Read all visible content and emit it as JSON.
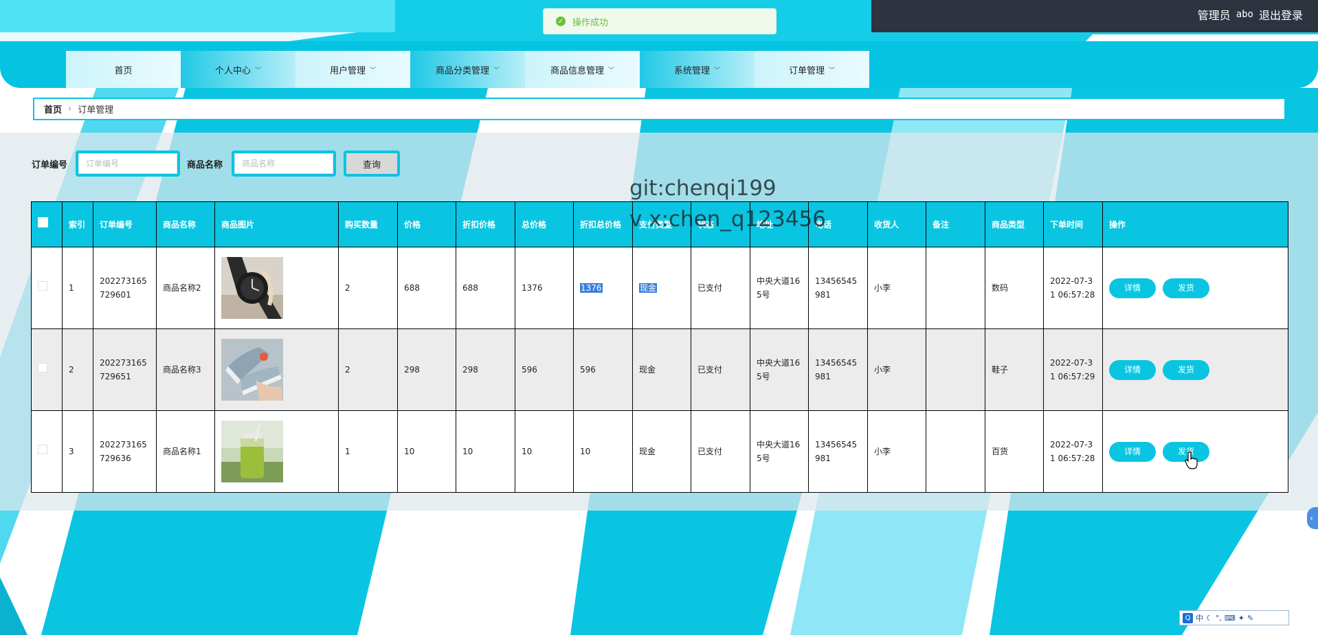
{
  "header": {
    "role": "管理员",
    "username": "abo",
    "logout": "退出登录"
  },
  "toast": {
    "message": "操作成功"
  },
  "nav": [
    {
      "label": "首页",
      "dropdown": false
    },
    {
      "label": "个人中心",
      "dropdown": true
    },
    {
      "label": "用户管理",
      "dropdown": true
    },
    {
      "label": "商品分类管理",
      "dropdown": true
    },
    {
      "label": "商品信息管理",
      "dropdown": true
    },
    {
      "label": "系统管理",
      "dropdown": true
    },
    {
      "label": "订单管理",
      "dropdown": true
    }
  ],
  "breadcrumb": {
    "home": "首页",
    "current": "订单管理"
  },
  "search": {
    "order_no_label": "订单编号",
    "order_no_placeholder": "订单编号",
    "product_name_label": "商品名称",
    "product_name_placeholder": "商品名称",
    "query_label": "查询"
  },
  "watermark": {
    "line1": "git:chenqi199",
    "line2": "v x:chen_q123456"
  },
  "table": {
    "headers": [
      "索引",
      "订单编号",
      "商品名称",
      "商品图片",
      "购买数量",
      "价格",
      "折扣价格",
      "总价格",
      "折扣总价格",
      "支付类型",
      "状态",
      "地址",
      "电话",
      "收货人",
      "备注",
      "商品类型",
      "下单时间",
      "操作"
    ],
    "rows": [
      {
        "index": "1",
        "order_no": "202273165729601",
        "name": "商品名称2",
        "image": "watch",
        "qty": "2",
        "price": "688",
        "discount_price": "688",
        "total": "1376",
        "discount_total": "1376",
        "pay": "现金",
        "status": "已支付",
        "address": "中央大道165号",
        "phone": "13456545981",
        "receiver": "小李",
        "remark": "",
        "type": "数码",
        "time": "2022-07-31 06:57:28"
      },
      {
        "index": "2",
        "order_no": "202273165729651",
        "name": "商品名称3",
        "image": "shoes",
        "qty": "2",
        "price": "298",
        "discount_price": "298",
        "total": "596",
        "discount_total": "596",
        "pay": "现金",
        "status": "已支付",
        "address": "中央大道165号",
        "phone": "13456545981",
        "receiver": "小李",
        "remark": "",
        "type": "鞋子",
        "time": "2022-07-31 06:57:29"
      },
      {
        "index": "3",
        "order_no": "202273165729636",
        "name": "商品名称1",
        "image": "bottle",
        "qty": "1",
        "price": "10",
        "discount_price": "10",
        "total": "10",
        "discount_total": "10",
        "pay": "现金",
        "status": "已支付",
        "address": "中央大道165号",
        "phone": "13456545981",
        "receiver": "小李",
        "remark": "",
        "type": "百货",
        "time": "2022-07-31 06:57:28"
      }
    ],
    "actions": {
      "detail": "详情",
      "ship": "发货"
    }
  },
  "ime": {
    "logo": "Q",
    "mode": "中"
  },
  "colors": {
    "accent": "#09c5e2",
    "dark_bar": "#2d3440",
    "success": "#67c23a",
    "selection": "#3b7ee0"
  }
}
